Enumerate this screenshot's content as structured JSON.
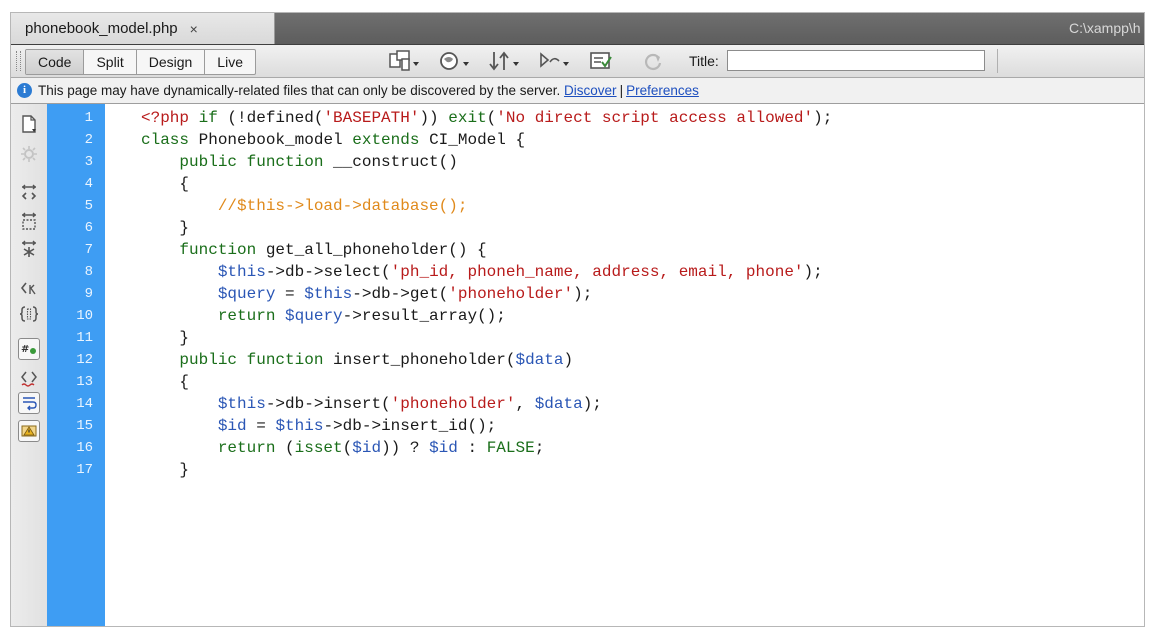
{
  "tab": {
    "filename": "phonebook_model.php",
    "close": "×",
    "path": "C:\\xampp\\h"
  },
  "toolbar": {
    "views": [
      "Code",
      "Split",
      "Design",
      "Live"
    ],
    "title_label": "Title:",
    "title_value": "",
    "icons": [
      "multiscreen-icon",
      "preview-browser-icon",
      "file-management-icon",
      "visual-aids-icon",
      "validate-icon",
      "refresh-icon"
    ]
  },
  "infobar": {
    "message": "This page may have dynamically-related files that can only be discovered by the server.",
    "discover": "Discover",
    "separator": "|",
    "preferences": "Preferences"
  },
  "sidebar": {
    "icons": [
      "open-documents-icon",
      "show-code-navigator-icon",
      "collapse-full-tag-icon",
      "collapse-selection-icon",
      "expand-all-icon",
      "select-parent-tag-icon",
      "balance-braces-icon",
      "line-numbers-icon",
      "highlight-invalid-code-icon",
      "word-wrap-icon",
      "syntax-error-alerts-icon"
    ]
  },
  "colors": {
    "gutter": "#3e9df3",
    "keyword": "#1a6e1a",
    "string": "#b81b1b",
    "variable": "#2a56b5",
    "comment": "#e08a1c"
  },
  "code": {
    "line_numbers": [
      "1",
      "2",
      "3",
      "4",
      "5",
      "6",
      "7",
      "8",
      "9",
      "10",
      "11",
      "12",
      "13",
      "14",
      "15",
      "16",
      "17"
    ],
    "lines": [
      [
        [
          "php",
          "<?php "
        ],
        [
          "kw",
          "if"
        ],
        [
          "punc",
          " (!defined("
        ],
        [
          "str",
          "'BASEPATH'"
        ],
        [
          "punc",
          ")) "
        ],
        [
          "kw",
          "exit"
        ],
        [
          "punc",
          "("
        ],
        [
          "str",
          "'No direct script access allowed'"
        ],
        [
          "punc",
          ");"
        ]
      ],
      [
        [
          "kw",
          "class"
        ],
        [
          "punc",
          " Phonebook_model "
        ],
        [
          "kw",
          "extends"
        ],
        [
          "punc",
          " CI_Model {"
        ]
      ],
      [
        [
          "punc",
          "    "
        ],
        [
          "kw",
          "public function"
        ],
        [
          "punc",
          " __construct()"
        ]
      ],
      [
        [
          "punc",
          "    {"
        ]
      ],
      [
        [
          "punc",
          "        "
        ],
        [
          "cmt",
          "//$this->load->database();"
        ]
      ],
      [
        [
          "punc",
          "    }"
        ]
      ],
      [
        [
          "punc",
          "    "
        ],
        [
          "kw",
          "function"
        ],
        [
          "punc",
          " get_all_phoneholder() {"
        ]
      ],
      [
        [
          "punc",
          "        "
        ],
        [
          "var",
          "$this"
        ],
        [
          "punc",
          "->db->select("
        ],
        [
          "str",
          "'ph_id, phoneh_name, address, email, phone'"
        ],
        [
          "punc",
          ");"
        ]
      ],
      [
        [
          "punc",
          "        "
        ],
        [
          "var",
          "$query"
        ],
        [
          "punc",
          " = "
        ],
        [
          "var",
          "$this"
        ],
        [
          "punc",
          "->db->get("
        ],
        [
          "str",
          "'phoneholder'"
        ],
        [
          "punc",
          ");"
        ]
      ],
      [
        [
          "punc",
          "        "
        ],
        [
          "kw",
          "return"
        ],
        [
          "punc",
          " "
        ],
        [
          "var",
          "$query"
        ],
        [
          "punc",
          "->result_array();"
        ]
      ],
      [
        [
          "punc",
          "    }"
        ]
      ],
      [
        [
          "punc",
          "    "
        ],
        [
          "kw",
          "public function"
        ],
        [
          "punc",
          " insert_phoneholder("
        ],
        [
          "var",
          "$data"
        ],
        [
          "punc",
          ")"
        ]
      ],
      [
        [
          "punc",
          "    {"
        ]
      ],
      [
        [
          "punc",
          "        "
        ],
        [
          "var",
          "$this"
        ],
        [
          "punc",
          "->db->insert("
        ],
        [
          "str",
          "'phoneholder'"
        ],
        [
          "punc",
          ", "
        ],
        [
          "var",
          "$data"
        ],
        [
          "punc",
          ");"
        ]
      ],
      [
        [
          "punc",
          "        "
        ],
        [
          "var",
          "$id"
        ],
        [
          "punc",
          " = "
        ],
        [
          "var",
          "$this"
        ],
        [
          "punc",
          "->db->insert_id();"
        ]
      ],
      [
        [
          "punc",
          "        "
        ],
        [
          "kw",
          "return"
        ],
        [
          "punc",
          " ("
        ],
        [
          "kw",
          "isset"
        ],
        [
          "punc",
          "("
        ],
        [
          "var",
          "$id"
        ],
        [
          "punc",
          ")) ? "
        ],
        [
          "var",
          "$id"
        ],
        [
          "punc",
          " : "
        ],
        [
          "kw",
          "FALSE"
        ],
        [
          "punc",
          ";"
        ]
      ],
      [
        [
          "punc",
          "    }"
        ]
      ]
    ]
  }
}
